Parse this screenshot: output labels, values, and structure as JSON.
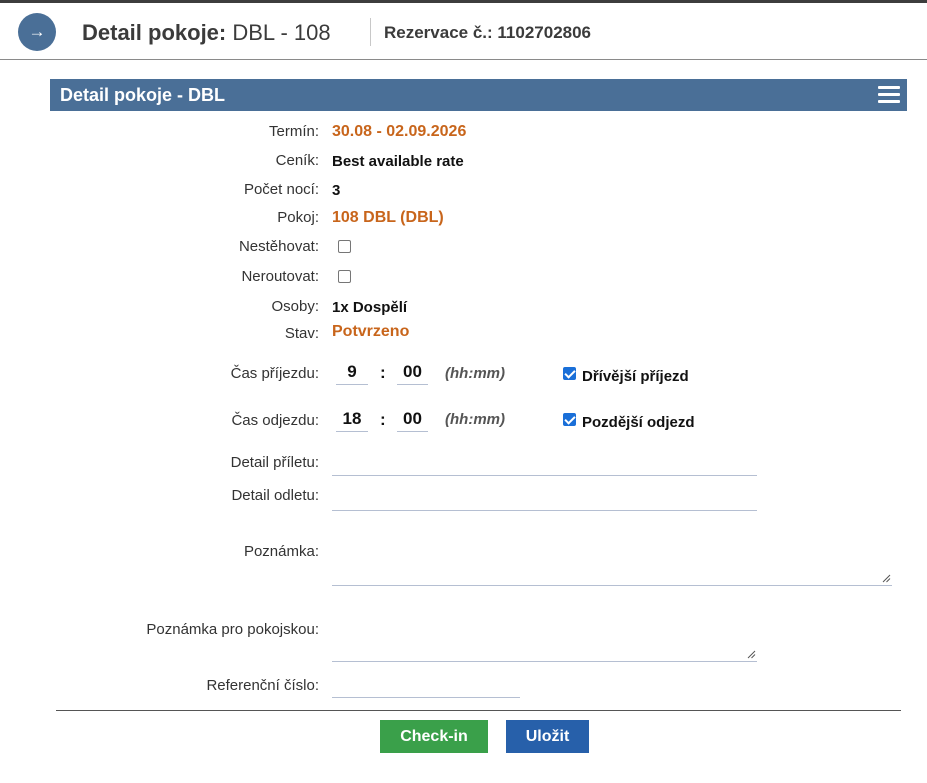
{
  "header": {
    "title_bold": "Detail pokoje:",
    "title_room": "DBL - 108",
    "reservation": "Rezervace č.: 1102702806"
  },
  "panel": {
    "title": "Detail pokoje - DBL"
  },
  "fields": {
    "termin_label": "Termín:",
    "termin_value": "30.08 - 02.09.2026",
    "cenik_label": "Ceník:",
    "cenik_value": "Best available rate",
    "noci_label": "Počet nocí:",
    "noci_value": "3",
    "pokoj_label": "Pokoj:",
    "pokoj_value": "108 DBL (DBL)",
    "nestehovat_label": "Nestěhovat:",
    "nestehovat_checked": false,
    "neroutovat_label": "Neroutovat:",
    "neroutovat_checked": false,
    "osoby_label": "Osoby:",
    "osoby_value": "1x Dospělí",
    "stav_label": "Stav:",
    "stav_value": "Potvrzeno"
  },
  "arrival": {
    "label": "Čas příjezdu:",
    "hours": "9",
    "minutes": "00",
    "separator": ":",
    "hint": "(hh:mm)",
    "early_label": "Dřívější příjezd",
    "early_checked": true
  },
  "departure": {
    "label": "Čas odjezdu:",
    "hours": "18",
    "minutes": "00",
    "separator": ":",
    "hint": "(hh:mm)",
    "late_label": "Pozdější odjezd",
    "late_checked": true
  },
  "flight": {
    "arrival_label": "Detail příletu:",
    "arrival_value": "",
    "departure_label": "Detail odletu:",
    "departure_value": ""
  },
  "notes": {
    "note_label": "Poznámka:",
    "note_value": "",
    "housekeeping_label": "Poznámka pro pokojskou:",
    "housekeeping_value": "",
    "reference_label": "Referenční číslo:",
    "reference_value": ""
  },
  "buttons": {
    "checkin": "Check-in",
    "save": "Uložit"
  },
  "colors": {
    "accent": "#4a6f97",
    "highlight": "#c8651b",
    "checkin": "#3aa04a",
    "save": "#2760aa"
  }
}
